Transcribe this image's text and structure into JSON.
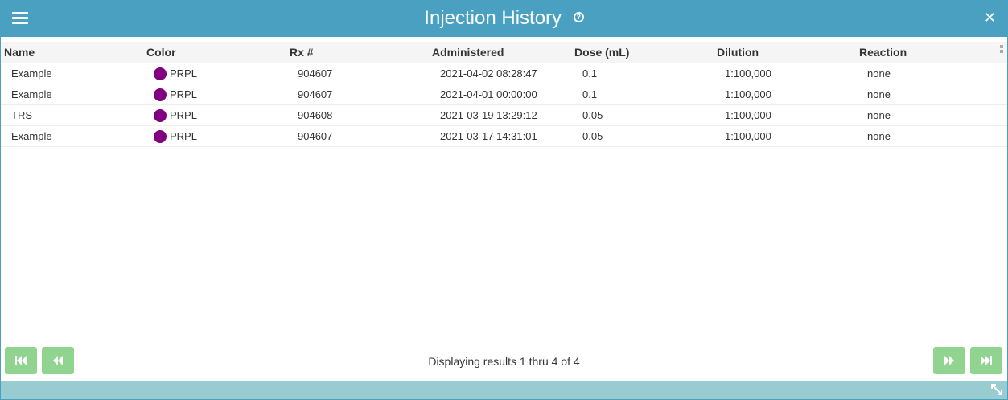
{
  "window": {
    "title": "Injection History",
    "help_icon": "?",
    "close_icon": "✕"
  },
  "columns": {
    "name": "Name",
    "color": "Color",
    "rx": "Rx #",
    "administered": "Administered",
    "dose": "Dose (mL)",
    "dilution": "Dilution",
    "reaction": "Reaction"
  },
  "rows": [
    {
      "name": "Example",
      "color_label": "PRPL",
      "color_hex": "#800080",
      "rx": "904607",
      "administered": "2021-04-02 08:28:47",
      "dose": "0.1",
      "dilution": "1:100,000",
      "reaction": "none"
    },
    {
      "name": "Example",
      "color_label": "PRPL",
      "color_hex": "#800080",
      "rx": "904607",
      "administered": "2021-04-01 00:00:00",
      "dose": "0.1",
      "dilution": "1:100,000",
      "reaction": "none"
    },
    {
      "name": "TRS",
      "color_label": "PRPL",
      "color_hex": "#800080",
      "rx": "904608",
      "administered": "2021-03-19 13:29:12",
      "dose": "0.05",
      "dilution": "1:100,000",
      "reaction": "none"
    },
    {
      "name": "Example",
      "color_label": "PRPL",
      "color_hex": "#800080",
      "rx": "904607",
      "administered": "2021-03-17 14:31:01",
      "dose": "0.05",
      "dilution": "1:100,000",
      "reaction": "none"
    }
  ],
  "pager": {
    "info": "Displaying results 1 thru 4 of 4"
  },
  "colors": {
    "header_bg": "#4aa0c0",
    "footer_bg": "#98ccd0",
    "pager_button": "#90d490"
  }
}
